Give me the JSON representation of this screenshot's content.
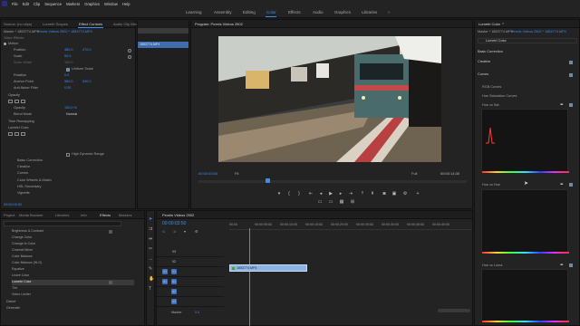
{
  "menu": [
    "File",
    "Edit",
    "Clip",
    "Sequence",
    "Markers",
    "Graphics",
    "Window",
    "Help"
  ],
  "workspaces": [
    "Learning",
    "Assembly",
    "Editing",
    "Color",
    "Effects",
    "Audio",
    "Graphics",
    "Libraries"
  ],
  "active_workspace": "Color",
  "effect_controls": {
    "tabs": [
      "Source: (no clips)",
      "Lumetri Scopes",
      "Effect Controls",
      "Audio Clip Mixer: Pexels Videos 2502"
    ],
    "active_tab": "Effect Controls",
    "master": "Master * 1853774.MP4",
    "sequence": "Pexels Videos 2502 * 1853774.MP4",
    "clip_label": "1853774.MP4",
    "video_effects": "Video Effects",
    "motion": "Motion",
    "position_label": "Position",
    "position_x": "480.0",
    "position_y": "270.0",
    "scale_label": "Scale",
    "scale_value": "50.0",
    "scale_width_label": "Scale Width",
    "scale_width_value": "100.0",
    "uniform_scale": "Uniform Scale",
    "rotation_label": "Rotation",
    "rotation_value": "0.0",
    "anchor_label": "Anchor Point",
    "anchor_x": "960.0",
    "anchor_y": "540.0",
    "flicker_label": "Anti-flicker Filter",
    "flicker_value": "0.00",
    "opacity": "Opacity",
    "opacity_label": "Opacity",
    "opacity_value": "100.0 %",
    "blend_label": "Blend Mode",
    "blend_value": "Normal",
    "time_remap": "Time Remapping",
    "lumetri": "Lumetri Color",
    "hdr": "High Dynamic Range",
    "sections": [
      "Basic Correction",
      "Creative",
      "Curves",
      "Color Wheels & Match",
      "HSL Secondary",
      "Vignette"
    ],
    "timecode": "00:00:03:50"
  },
  "program": {
    "title": "Program: Pexels Videos 2502",
    "timecode": "00:00:03:50",
    "fit": "Fit",
    "full": "Full",
    "duration": "00:00:14:30"
  },
  "project": {
    "tabs": [
      "Project",
      "Media Browser",
      "Libraries",
      "Info",
      "Effects",
      "Markers"
    ],
    "active_tab": "Effects",
    "items": [
      "Brightness & Contrast",
      "Change Color",
      "Change to Color",
      "Channel Mixer",
      "Color Balance",
      "Color Balance (HLS)",
      "Equalize",
      "Leave Color",
      "Lumetri Color",
      "Tint",
      "Video Limiter"
    ],
    "selected": "Lumetri Color",
    "folders": [
      "Distort",
      "Generate"
    ]
  },
  "timeline": {
    "title": "Pexels Videos 2502",
    "timecode": "00:00:03:50",
    "ruler": [
      "00:00",
      "00:00:05:00",
      "00:00:10:00",
      "00:00:15:00",
      "00:00:20:00",
      "00:00:25:00",
      "00:00:30:00",
      "00:00:35:00",
      "00:00:40:00"
    ],
    "video_tracks": [
      "V3",
      "V2",
      "V1"
    ],
    "audio_tracks": [
      "A1",
      "A2",
      "A3"
    ],
    "master": "Master",
    "master_val": "0.0",
    "clip": "1853774.MP4",
    "track_buttons": [
      "V1",
      "A1"
    ]
  },
  "lumetri": {
    "title": "Lumetri Color",
    "master": "Master * 1853774.MP4",
    "sequence": "Pexels Videos 2502 * 1853774.MP4",
    "effect": "Lumetri Color",
    "basic": "Basic Correction",
    "creative": "Creative",
    "curves": "Curves",
    "rgb": "RGB Curves",
    "hue_sat": "Hue Saturation Curves",
    "graphs": [
      "Hue vs Sat",
      "Hue vs Hue",
      "Hue vs Luma"
    ]
  },
  "colors": {
    "accent": "#3d8ef0",
    "clip": "#8fb4e3",
    "bg": "#1d1d1d",
    "panel": "#232323"
  }
}
